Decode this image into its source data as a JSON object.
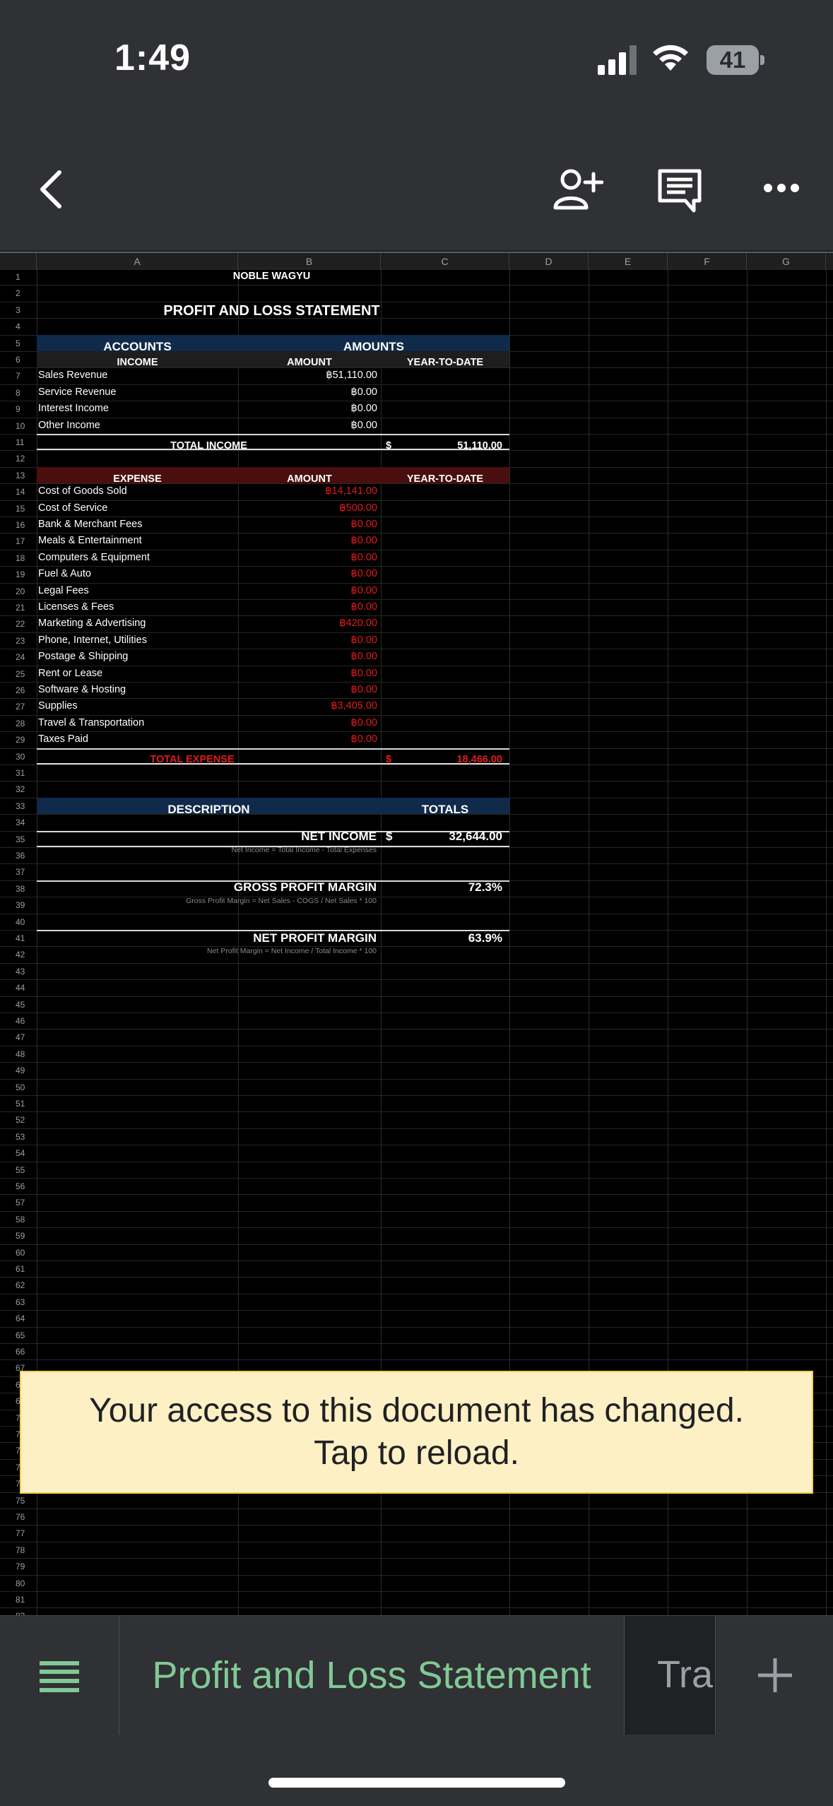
{
  "status_bar": {
    "time": "1:49",
    "battery": "41"
  },
  "toolbar": {
    "back_icon": "chevron-left-icon",
    "share_icon": "add-person-icon",
    "comment_icon": "comment-icon",
    "more_icon": "more-horizontal-icon"
  },
  "columns": [
    "A",
    "B",
    "C",
    "D",
    "E",
    "F",
    "G"
  ],
  "row_numbers": [
    "1",
    "2",
    "3",
    "4",
    "5",
    "6",
    "7",
    "8",
    "9",
    "10",
    "11",
    "12",
    "13",
    "14",
    "15",
    "16",
    "17",
    "18",
    "19",
    "20",
    "21",
    "22",
    "23",
    "24",
    "25",
    "26",
    "27",
    "28",
    "29",
    "30",
    "31",
    "32",
    "33",
    "34",
    "35",
    "36",
    "37",
    "38",
    "39",
    "40",
    "41",
    "42",
    "43",
    "44",
    "45",
    "46",
    "47",
    "48",
    "49",
    "50",
    "51",
    "52",
    "53",
    "54",
    "55",
    "56",
    "57",
    "58",
    "59",
    "60",
    "61",
    "62",
    "63",
    "64",
    "65",
    "66",
    "67",
    "68",
    "69",
    "70",
    "71",
    "72",
    "73",
    "74",
    "75",
    "76",
    "77",
    "78",
    "79",
    "80",
    "81",
    "82"
  ],
  "sheet": {
    "company": "NOBLE WAGYU",
    "title": "PROFIT AND LOSS STATEMENT",
    "accounts_header": "ACCOUNTS",
    "amounts_header": "AMOUNTS",
    "income": {
      "label": "INCOME",
      "amount_label": "AMOUNT",
      "ytd_label": "YEAR-TO-DATE",
      "rows": [
        {
          "name": "Sales Revenue",
          "amount": "฿51,110.00"
        },
        {
          "name": "Service Revenue",
          "amount": "฿0.00"
        },
        {
          "name": "Interest Income",
          "amount": "฿0.00"
        },
        {
          "name": "Other Income",
          "amount": "฿0.00"
        }
      ],
      "total_label": "TOTAL INCOME",
      "total_currency": "$",
      "total_value": "51,110.00"
    },
    "expense": {
      "label": "EXPENSE",
      "amount_label": "AMOUNT",
      "ytd_label": "YEAR-TO-DATE",
      "rows": [
        {
          "name": "Cost of Goods Sold",
          "amount": "฿14,141.00"
        },
        {
          "name": "Cost of Service",
          "amount": "฿500.00"
        },
        {
          "name": "Bank & Merchant Fees",
          "amount": "฿0.00"
        },
        {
          "name": "Meals & Entertainment",
          "amount": "฿0.00"
        },
        {
          "name": "Computers & Equipment",
          "amount": "฿0.00"
        },
        {
          "name": "Fuel & Auto",
          "amount": "฿0.00"
        },
        {
          "name": "Legal Fees",
          "amount": "฿0.00"
        },
        {
          "name": "Licenses & Fees",
          "amount": "฿0.00"
        },
        {
          "name": "Marketing & Advertising",
          "amount": "฿420.00"
        },
        {
          "name": "Phone, Internet, Utilities",
          "amount": "฿0.00"
        },
        {
          "name": "Postage & Shipping",
          "amount": "฿0.00"
        },
        {
          "name": "Rent or Lease",
          "amount": "฿0.00"
        },
        {
          "name": "Software & Hosting",
          "amount": "฿0.00"
        },
        {
          "name": "Supplies",
          "amount": "฿3,405.00"
        },
        {
          "name": "Travel & Transportation",
          "amount": "฿0.00"
        },
        {
          "name": "Taxes Paid",
          "amount": "฿0.00"
        }
      ],
      "total_label": "TOTAL EXPENSE",
      "total_currency": "$",
      "total_value": "18,466.00"
    },
    "summary": {
      "description_label": "DESCRIPTION",
      "totals_label": "TOTALS",
      "net_income_label": "NET INCOME",
      "net_income_currency": "$",
      "net_income_value": "32,644.00",
      "net_income_formula": "Net Income = Total Income - Total Expenses",
      "gross_margin_label": "GROSS PROFIT MARGIN",
      "gross_margin_value": "72.3%",
      "gross_margin_formula": "Gross Profit Margin = Net Sales - COGS / Net Sales * 100",
      "net_margin_label": "NET PROFIT MARGIN",
      "net_margin_value": "63.9%",
      "net_margin_formula": "Net Profit Margin = Net Income / Total Income * 100"
    }
  },
  "banner": {
    "line1": "Your access to this document has changed.",
    "line2": "Tap to reload."
  },
  "sheet_tabs": {
    "menu_icon": "list-icon",
    "active_tab": "Profit and Loss Statement",
    "next_tab": "Tra",
    "add_icon": "plus-icon"
  },
  "colors": {
    "header_blue": "#0f2a4a",
    "header_red": "#4a0e0e",
    "expense_red": "#e21b1b",
    "accent_green": "#81c995",
    "banner_bg": "#fdf0c4"
  }
}
